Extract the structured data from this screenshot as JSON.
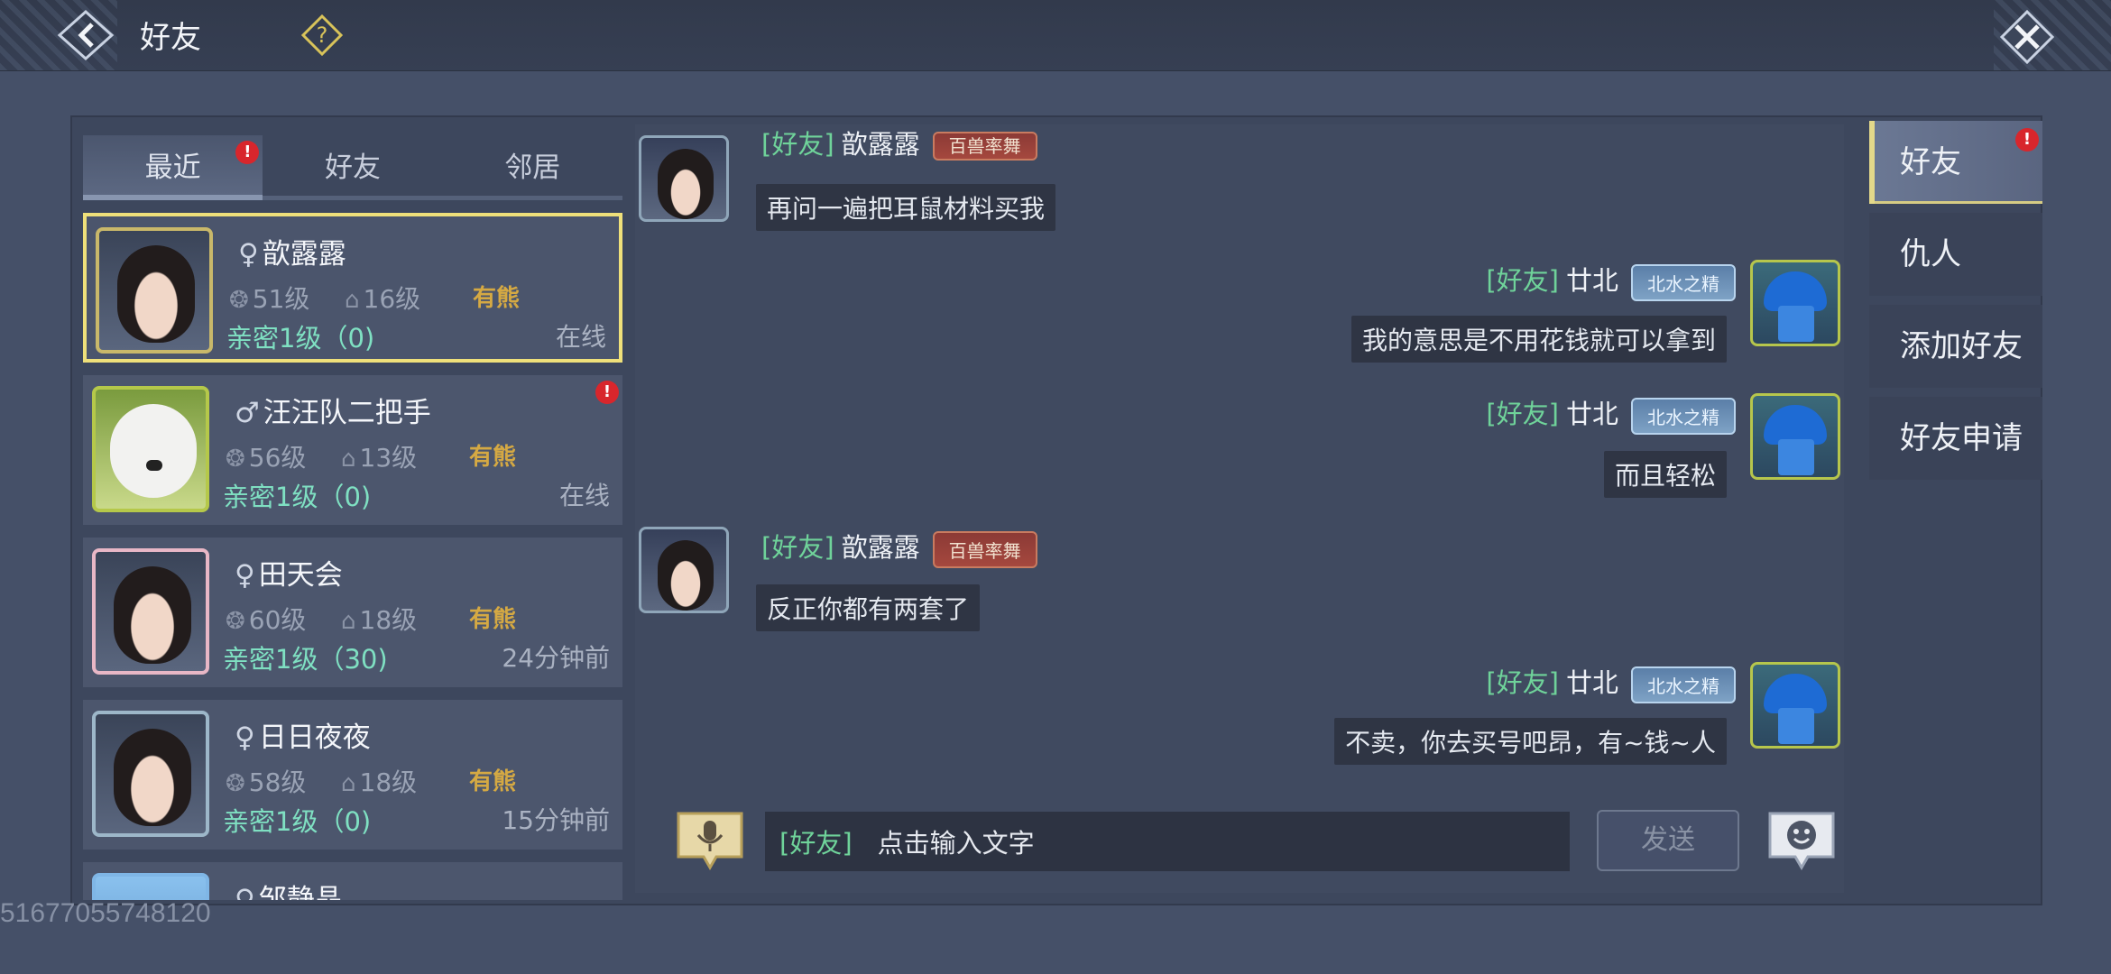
{
  "header": {
    "title": "好友"
  },
  "tabs": [
    {
      "label": "最近",
      "active": true,
      "badge": "!"
    },
    {
      "label": "好友",
      "active": false
    },
    {
      "label": "邻居",
      "active": false
    }
  ],
  "friends": [
    {
      "name": "歆露露",
      "gender_symbol": "♀",
      "level": "51级",
      "home_level": "16级",
      "mood": "有熊",
      "intimacy": "亲密1级（0)",
      "status": "在线",
      "selected": true
    },
    {
      "name": "汪汪队二把手",
      "gender_symbol": "♂",
      "level": "56级",
      "home_level": "13级",
      "mood": "有熊",
      "intimacy": "亲密1级（0)",
      "status": "在线",
      "badge": "!"
    },
    {
      "name": "田天会",
      "gender_symbol": "♀",
      "level": "60级",
      "home_level": "18级",
      "mood": "有熊",
      "intimacy": "亲密1级（30)",
      "status": "24分钟前"
    },
    {
      "name": "日日夜夜",
      "gender_symbol": "♀",
      "level": "58级",
      "home_level": "18级",
      "mood": "有熊",
      "intimacy": "亲密1级（0)",
      "status": "15分钟前"
    },
    {
      "name": "邹静晶",
      "gender_symbol": "♀"
    }
  ],
  "chat": {
    "messages": [
      {
        "side": "left",
        "tag": "[好友]",
        "sender": "歆露露",
        "title": "百兽率舞",
        "text": "再问一遍把耳鼠材料买我"
      },
      {
        "side": "right",
        "tag": "[好友]",
        "sender": "廿北",
        "title": "北水之精",
        "text": "我的意思是不用花钱就可以拿到"
      },
      {
        "side": "right",
        "tag": "[好友]",
        "sender": "廿北",
        "title": "北水之精",
        "text": "而且轻松"
      },
      {
        "side": "left",
        "tag": "[好友]",
        "sender": "歆露露",
        "title": "百兽率舞",
        "text": "反正你都有两套了"
      },
      {
        "side": "right",
        "tag": "[好友]",
        "sender": "廿北",
        "title": "北水之精",
        "text": "不卖，你去买号吧昂，有~钱~人"
      }
    ],
    "input": {
      "tag": "[好友]",
      "placeholder": "点击输入文字"
    },
    "send_label": "发送"
  },
  "right_nav": [
    {
      "label": "好友",
      "active": true,
      "badge": "!"
    },
    {
      "label": "仇人"
    },
    {
      "label": "添加好友"
    },
    {
      "label": "好友申请"
    }
  ],
  "footer_id": "51677055748120",
  "colors": {
    "accent_green": "#6fd39a",
    "intimacy": "#7fe0c2",
    "mood_gold": "#d5a943",
    "selected_border": "#efe07a",
    "badge_red": "#d8262c"
  }
}
